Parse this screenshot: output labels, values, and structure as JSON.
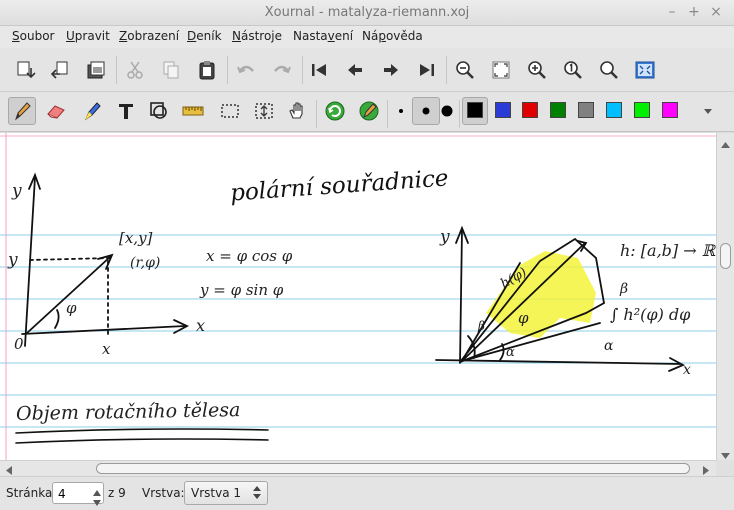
{
  "window": {
    "title": "Xournal - matalyza-riemann.xoj"
  },
  "menu": [
    {
      "label": "Soubor",
      "underline": "S"
    },
    {
      "label": "Upravit",
      "underline": "U"
    },
    {
      "label": "Zobrazení",
      "underline": "Z"
    },
    {
      "label": "Deník",
      "underline": "D"
    },
    {
      "label": "Nástroje",
      "underline": "N"
    },
    {
      "label": "Nastavení",
      "underline": "v"
    },
    {
      "label": "Nápověda",
      "underline": "p"
    }
  ],
  "colors": {
    "black": "#000000",
    "blue": "#2b3bd6",
    "red": "#e00000",
    "green": "#008000",
    "gray": "#808080",
    "light_blue": "#00bfff",
    "light_green": "#00f000",
    "magenta": "#ff00ff",
    "highlight": "#f2f22e",
    "ruling": "#8fcfe8",
    "margin": "#f0a0c8"
  },
  "note": {
    "title": "polární souřadnice",
    "left_axis_y": "y",
    "left_axis_x": "x",
    "point": "[x,y]",
    "polar": "(r,φ)",
    "y_mark": "y",
    "x_mark": "x",
    "origin": "0",
    "angle": "φ",
    "eq1": "x = φ cos φ",
    "eq2": "y = φ sin φ",
    "right_axis_y": "y",
    "right_axis_x": "x",
    "h_label": "h(φ)",
    "phi_label": "φ",
    "alpha": "α",
    "beta_small": "β",
    "func": "h: [a,b] → ℝ",
    "integral_upper": "β",
    "integral_lower": "α",
    "integral": "∫ h²(φ) dφ",
    "heading2": "Objem rotačního tělesa"
  },
  "status": {
    "page_label": "Stránka",
    "page_value": "4",
    "page_total": "z 9",
    "layer_label": "Vrstva:",
    "layer_value": "Vrstva 1"
  }
}
